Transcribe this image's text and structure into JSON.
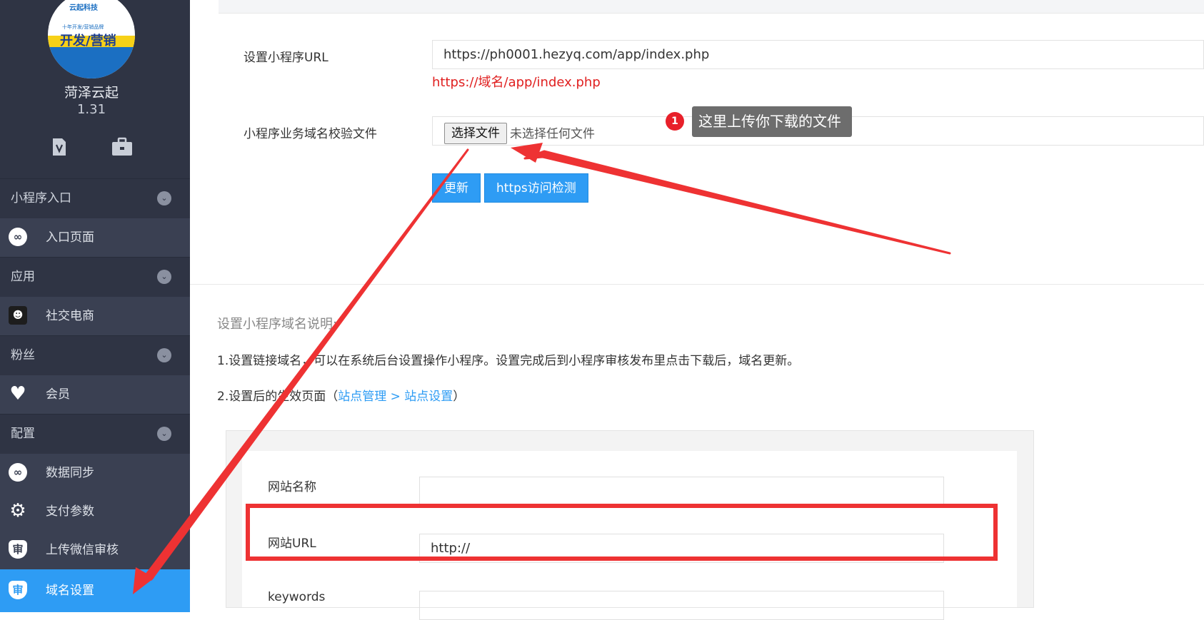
{
  "sidebar": {
    "logo": {
      "brand_text": "云起科技",
      "tagline": "十年开发/营销品牌",
      "main_text": "开发/营销"
    },
    "brand_name": "菏泽云起",
    "version": "1.31",
    "icons": [
      "version-icon",
      "briefcase-icon"
    ],
    "groups": [
      {
        "label": "小程序入口",
        "items": [
          {
            "label": "入口页面",
            "icon": "link-icon"
          }
        ]
      },
      {
        "label": "应用",
        "items": [
          {
            "label": "社交电商",
            "icon": "avatar-icon"
          }
        ]
      },
      {
        "label": "粉丝",
        "items": [
          {
            "label": "会员",
            "icon": "heart-icon"
          }
        ]
      },
      {
        "label": "配置",
        "items": [
          {
            "label": "数据同步",
            "icon": "link-icon"
          },
          {
            "label": "支付参数",
            "icon": "gear-icon"
          },
          {
            "label": "上传微信审核",
            "icon": "shield-icon"
          },
          {
            "label": "域名设置",
            "icon": "shield-icon",
            "active": true
          }
        ]
      }
    ]
  },
  "form": {
    "url_label": "设置小程序URL",
    "url_value": "https://ph0001.hezyq.com/app/index.php",
    "url_hint": "https://域名/app/index.php",
    "file_label": "小程序业务域名校验文件",
    "file_button": "选择文件",
    "file_status": "未选择任何文件",
    "update_button": "更新",
    "check_button": "https访问检测"
  },
  "annotation": {
    "badge": "1",
    "tooltip": "这里上传你下载的文件"
  },
  "description": {
    "title": "设置小程序域名说明:",
    "line1": "1.设置链接域名，可以在系统后台设置操作小程序。设置完成后到小程序审核发布里点击下载后，域名更新。",
    "line2_prefix": "2.设置后的生效页面（",
    "line2_link1": "站点管理",
    "line2_sep": " > ",
    "line2_link2": "站点设置",
    "line2_suffix": "）"
  },
  "site_settings": {
    "fields": [
      {
        "label": "网站名称",
        "value": ""
      },
      {
        "label": "网站URL",
        "value": "http://"
      },
      {
        "label": "keywords",
        "value": ""
      }
    ]
  },
  "colors": {
    "sidebar_bg": "#2f3444",
    "accent": "#2e9cf4",
    "hint_red": "#e02020",
    "annotation_red": "#ee3233"
  }
}
